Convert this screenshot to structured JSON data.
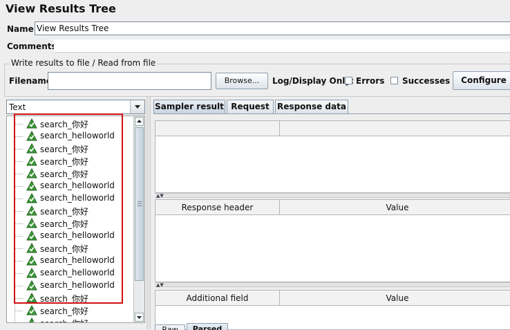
{
  "window": {
    "title": "View Results Tree"
  },
  "form": {
    "name_label": "Name:",
    "name_value": "View Results Tree",
    "comments_label": "Comments:"
  },
  "file_group": {
    "legend": "Write results to file / Read from file",
    "filename_label": "Filename",
    "filename_value": "",
    "browse_label": "Browse...",
    "log_display_label": "Log/Display Only:",
    "errors_label": "Errors",
    "successes_label": "Successes",
    "configure_label": "Configure"
  },
  "renderer": {
    "selected": "Text"
  },
  "tree": {
    "items": [
      {
        "label": "search_你好"
      },
      {
        "label": "search_helloworld"
      },
      {
        "label": "search_你好"
      },
      {
        "label": "search_你好"
      },
      {
        "label": "search_你好"
      },
      {
        "label": "search_helloworld"
      },
      {
        "label": "search_helloworld"
      },
      {
        "label": "search_你好"
      },
      {
        "label": "search_你好"
      },
      {
        "label": "search_helloworld"
      },
      {
        "label": "search_你好"
      },
      {
        "label": "search_helloworld"
      },
      {
        "label": "search_helloworld"
      },
      {
        "label": "search_helloworld"
      },
      {
        "label": "search_你好"
      },
      {
        "label": "search_你好"
      },
      {
        "label": "search_你好"
      }
    ]
  },
  "tabs": [
    {
      "label": "Sampler result",
      "active": true
    },
    {
      "label": "Request",
      "active": false
    },
    {
      "label": "Response data",
      "active": false
    }
  ],
  "tables": {
    "response_header": {
      "col1": "Response header",
      "col2": "Value"
    },
    "additional_field": {
      "col1": "Additional field",
      "col2": "Value"
    }
  },
  "bottom_tabs": [
    {
      "label": "Raw"
    },
    {
      "label": "Parsed"
    }
  ],
  "colors": {
    "highlight_box": "#d11111",
    "tab_active": "#c8d4e2"
  }
}
